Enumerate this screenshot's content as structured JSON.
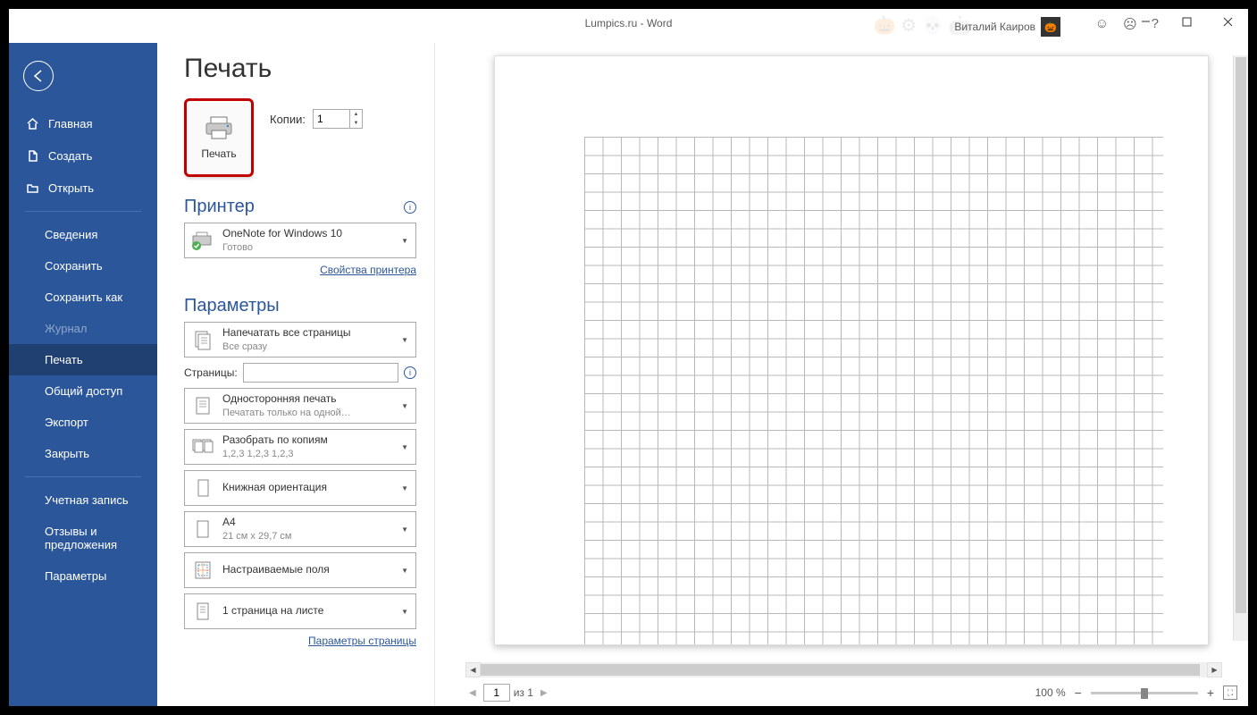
{
  "titlebar": {
    "title": "Lumpics.ru  -  Word",
    "user": "Виталий Каиров"
  },
  "sidebar": {
    "home": "Главная",
    "create": "Создать",
    "open": "Открыть",
    "info": "Сведения",
    "save": "Сохранить",
    "saveas": "Сохранить как",
    "history": "Журнал",
    "print": "Печать",
    "share": "Общий доступ",
    "export": "Экспорт",
    "close": "Закрыть",
    "account": "Учетная запись",
    "feedback1": "Отзывы и",
    "feedback2": "предложения",
    "options": "Параметры"
  },
  "page": {
    "title": "Печать",
    "print_label": "Печать",
    "copies_label": "Копии:",
    "copies_value": "1",
    "printer_header": "Принтер",
    "printer_name": "OneNote for Windows 10",
    "printer_status": "Готово",
    "printer_props": "Свойства принтера",
    "settings_header": "Параметры",
    "setting_pages_title": "Напечатать все страницы",
    "setting_pages_sub": "Все сразу",
    "pages_label": "Страницы:",
    "setting_side_title": "Односторонняя печать",
    "setting_side_sub": "Печатать только на одной…",
    "setting_collate_title": "Разобрать по копиям",
    "setting_collate_sub": "1,2,3    1,2,3    1,2,3",
    "setting_orient": "Книжная ориентация",
    "setting_size_title": "A4",
    "setting_size_sub": "21 см x 29,7 см",
    "setting_margins": "Настраиваемые поля",
    "setting_perpage": "1 страница на листе",
    "page_setup": "Параметры страницы"
  },
  "footer": {
    "page_current": "1",
    "page_of": "из 1",
    "zoom": "100 %"
  }
}
